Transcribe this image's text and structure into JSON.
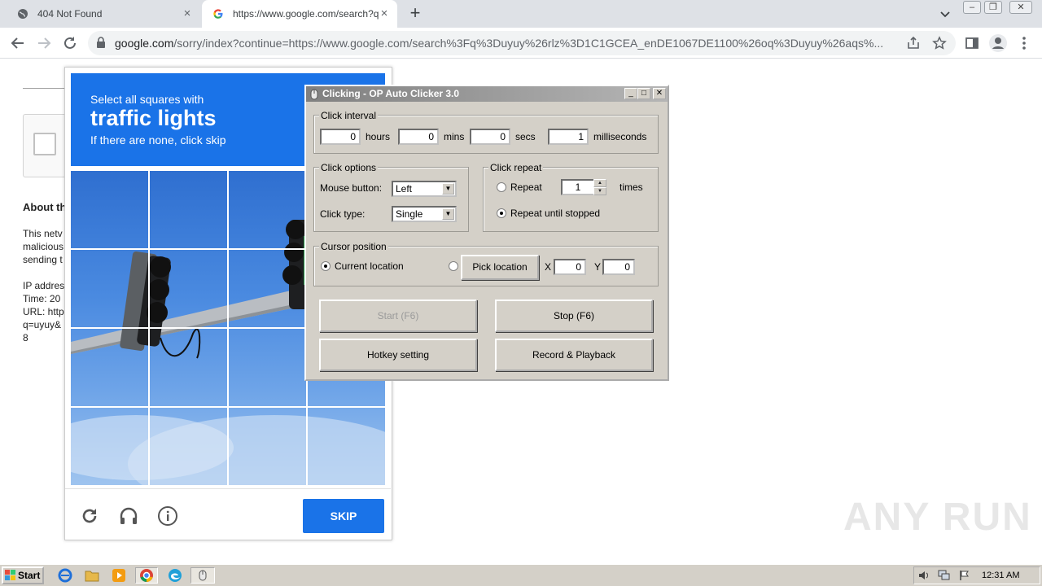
{
  "browser": {
    "tabs": [
      {
        "title": "404 Not Found"
      },
      {
        "title": "https://www.google.com/search?q="
      }
    ],
    "url_host": "google.com",
    "url_path": "/sorry/index?continue=https://www.google.com/search%3Fq%3Duyuy%26rlz%3D1C1GCEA_enDE1067DE1100%26oq%3Duyuy%26aqs%..."
  },
  "page": {
    "about_heading": "About th",
    "body_lines": [
      "This netv",
      "malicious",
      "sending t"
    ],
    "ip_label": "IP addres",
    "time_label": "Time: 20",
    "url_label": "URL: http",
    "q_label": "q=uyuy&",
    "last_line": "8"
  },
  "captcha": {
    "instruction_line1": "Select all squares with",
    "instruction_target": "traffic lights",
    "instruction_line3": "If there are none, click skip",
    "skip_label": "SKIP",
    "brand_color": "#1a73e8"
  },
  "clicker": {
    "title": "Clicking - OP Auto Clicker 3.0",
    "interval": {
      "label": "Click interval",
      "hours": "0",
      "hours_label": "hours",
      "mins": "0",
      "mins_label": "mins",
      "secs": "0",
      "secs_label": "secs",
      "ms": "1",
      "ms_label": "milliseconds"
    },
    "options": {
      "label": "Click options",
      "mouse_button_label": "Mouse button:",
      "mouse_button_value": "Left",
      "click_type_label": "Click type:",
      "click_type_value": "Single"
    },
    "repeat": {
      "label": "Click repeat",
      "repeat_label": "Repeat",
      "repeat_count": "1",
      "times_label": "times",
      "until_stopped_label": "Repeat until stopped",
      "selected": "until_stopped"
    },
    "cursor": {
      "label": "Cursor position",
      "current_label": "Current location",
      "pick_label": "Pick location",
      "x_label": "X",
      "x_value": "0",
      "y_label": "Y",
      "y_value": "0",
      "selected": "current"
    },
    "buttons": {
      "start": "Start (F6)",
      "stop": "Stop (F6)",
      "hotkey": "Hotkey setting",
      "record": "Record & Playback"
    }
  },
  "taskbar": {
    "start_label": "Start",
    "clock": "12:31 AM"
  },
  "watermark": "ANY RUN"
}
